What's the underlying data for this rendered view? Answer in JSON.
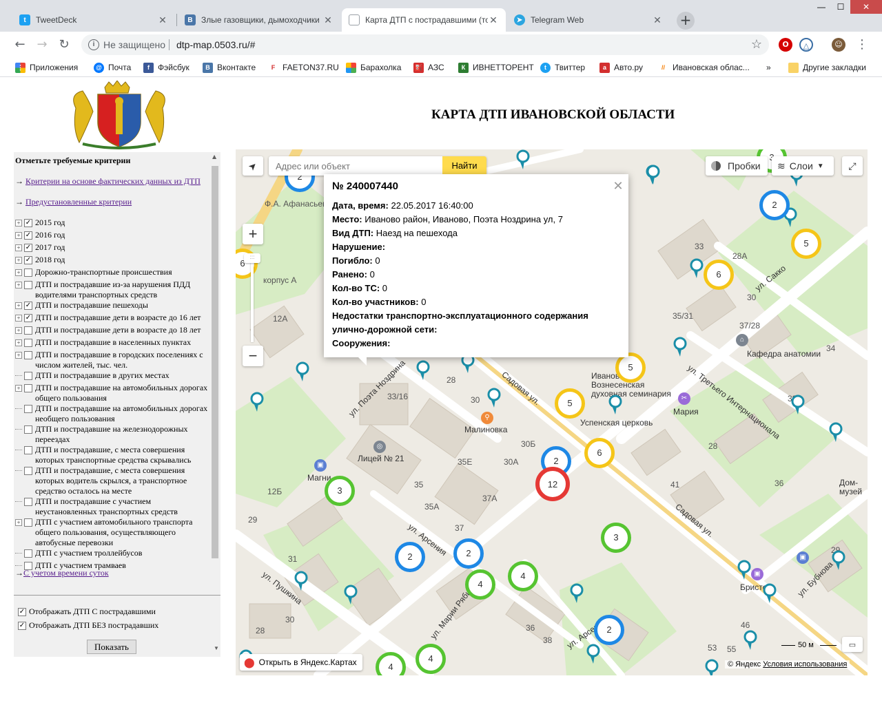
{
  "browser": {
    "tabs": [
      {
        "title": "TweetDeck",
        "active": false,
        "favicon": "twitter-icon",
        "color": "#1da1f2"
      },
      {
        "title": "Злые газовщики, дымоходчики",
        "active": false,
        "favicon": "vk-icon",
        "color": "#4a76a8"
      },
      {
        "title": "Карта ДТП с пострадавшими (то",
        "active": true,
        "favicon": "page-icon",
        "color": "#9aa0a6"
      },
      {
        "title": "Telegram Web",
        "active": false,
        "favicon": "telegram-icon",
        "color": "#2ca5e0"
      }
    ],
    "new_tab": "+",
    "window_buttons": {
      "minimize": "—",
      "maximize": "☐",
      "close": "✕"
    },
    "security_label": "Не защищено",
    "url": "dtp-map.0503.ru/#",
    "bookmarks": [
      {
        "label": "Приложения",
        "icon": "apps-icon",
        "color": "#ea4335"
      },
      {
        "label": "Почта",
        "icon": "mail-icon",
        "color": "#0078ff"
      },
      {
        "label": "Фэйсбук",
        "icon": "facebook-icon",
        "color": "#3b5998"
      },
      {
        "label": "Вконтакте",
        "icon": "vk-icon",
        "color": "#4a76a8"
      },
      {
        "label": "FAETON37.RU",
        "icon": "faeton-icon",
        "color": "#d32f2f"
      },
      {
        "label": "Барахолка",
        "icon": "baraholka-icon",
        "color": "#4caf50"
      },
      {
        "label": "АЗС",
        "icon": "azs-icon",
        "color": "#d32f2f"
      },
      {
        "label": "ИВНЕТТОРЕНТ",
        "icon": "torrent-icon",
        "color": "#2e7d32"
      },
      {
        "label": "Твиттер",
        "icon": "twitter-icon",
        "color": "#1da1f2"
      },
      {
        "label": "Авто.ру",
        "icon": "autoru-icon",
        "color": "#d32f2f"
      },
      {
        "label": "Ивановская облас...",
        "icon": "region-icon",
        "color": "#f57c00"
      }
    ],
    "bookmarks_more": "»",
    "other_bookmarks": "Другие закладки"
  },
  "page": {
    "title": "КАРТА ДТП ИВАНОВСКОЙ ОБЛАСТИ"
  },
  "sidebar": {
    "heading": "Отметьте требуемые критерии",
    "link_actual": "Критерии на основе фактических данных из ДТП",
    "link_preset": "Предустановленные критерии",
    "arrow": "→",
    "criteria": [
      {
        "label": "2015 год",
        "checked": true,
        "expandable": true
      },
      {
        "label": "2016 год",
        "checked": true,
        "expandable": true
      },
      {
        "label": "2017 год",
        "checked": true,
        "expandable": true
      },
      {
        "label": "2018 год",
        "checked": true,
        "expandable": true
      },
      {
        "label": "Дорожно-транспортные происшествия",
        "checked": false,
        "expandable": true
      },
      {
        "label": "ДТП и пострадавшие из-за нарушения ПДД водителями транспортных средств",
        "checked": false,
        "expandable": true
      },
      {
        "label": "ДТП и пострадавшие пешеходы",
        "checked": true,
        "expandable": true
      },
      {
        "label": "ДТП и пострадавшие дети в возрасте до 16 лет",
        "checked": true,
        "expandable": true
      },
      {
        "label": "ДТП и пострадавшие дети в возрасте до 18 лет",
        "checked": false,
        "expandable": true
      },
      {
        "label": "ДТП и пострадавшие в населенных пунктах",
        "checked": false,
        "expandable": true
      },
      {
        "label": "ДТП и пострадавшие в городских поселениях с числом жителей, тыс. чел.",
        "checked": false,
        "expandable": true
      },
      {
        "label": "ДТП и пострадавшие в других местах",
        "checked": false,
        "expandable": false
      },
      {
        "label": "ДТП и пострадавшие на автомобильных дорогах общего пользования",
        "checked": false,
        "expandable": true
      },
      {
        "label": "ДТП и пострадавшие на автомобильных дорогах необщего пользования",
        "checked": false,
        "expandable": false
      },
      {
        "label": "ДТП и пострадавшие на железнодорожных переездах",
        "checked": false,
        "expandable": false
      },
      {
        "label": "ДТП и пострадавшие, с места совершения которых транспортные средства скрывались",
        "checked": false,
        "expandable": false
      },
      {
        "label": "ДТП и пострадавшие, с места совершения которых водитель скрылся, а транспортное средство осталось на месте",
        "checked": false,
        "expandable": false
      },
      {
        "label": "ДТП и пострадавшие с участием неустановленных транспортных средств",
        "checked": false,
        "expandable": false
      },
      {
        "label": "ДТП с участием автомобильного транспорта общего пользования, осуществляющего автобусные перевозки",
        "checked": false,
        "expandable": true
      },
      {
        "label": "ДТП с участием троллейбусов",
        "checked": false,
        "expandable": false
      },
      {
        "label": "ДТП с участием трамваев",
        "checked": false,
        "expandable": false
      }
    ],
    "link_time": "С учетом времени суток",
    "opt_with_injured": "Отображать ДТП С пострадавшими",
    "opt_without_injured": "Отображать ДТП БЕЗ пострадавших",
    "show_button": "Показать"
  },
  "map": {
    "search_placeholder": "Адрес или объект",
    "find_button": "Найти",
    "traffic_button": "Пробки",
    "layers_button": "Слои",
    "zoom_in": "+",
    "zoom_out": "−",
    "open_in_yandex": "Открыть в Яндекс.Картах",
    "copyright": "© Яндекс",
    "terms": "Условия использования",
    "scale": "50 м",
    "colors": {
      "green": "#56c431",
      "blue": "#1e88e5",
      "yellow": "#f5c518",
      "red": "#e53935",
      "pin": "#1a8ea8"
    },
    "labels": [
      {
        "text": "ул. Поэта Ноздрина",
        "type": "street"
      },
      {
        "text": "Садовая ул.",
        "type": "street"
      },
      {
        "text": "ул. Сакко",
        "type": "street"
      },
      {
        "text": "ул. Третьего Интернационала",
        "type": "street"
      },
      {
        "text": "ул. Пушкина",
        "type": "street"
      },
      {
        "text": "ул. Арсения",
        "type": "street"
      },
      {
        "text": "ул. Марии Рябининой",
        "type": "street"
      },
      {
        "text": "ул. Бубнова",
        "type": "street"
      },
      {
        "text": "Ф.А. Афанасьев",
        "type": "poi"
      },
      {
        "text": "Кафедра анатомии",
        "type": "poi"
      },
      {
        "text": "Иваново-Вознесенская духовная семинария",
        "type": "poi"
      },
      {
        "text": "Успенская церковь",
        "type": "poi"
      },
      {
        "text": "Мария",
        "type": "poi"
      },
      {
        "text": "Малиновка",
        "type": "poi"
      },
      {
        "text": "Лицей № 21",
        "type": "poi"
      },
      {
        "text": "Магнит",
        "type": "poi"
      },
      {
        "text": "Дом-музей семьи Бубновых",
        "type": "poi"
      },
      {
        "text": "Бристоль",
        "type": "poi"
      },
      {
        "text": "корпус А",
        "type": "house"
      },
      {
        "text": "33/16",
        "type": "house"
      },
      {
        "text": "28",
        "type": "house"
      },
      {
        "text": "30",
        "type": "house"
      },
      {
        "text": "30Б",
        "type": "house"
      },
      {
        "text": "30А",
        "type": "house"
      },
      {
        "text": "35Е",
        "type": "house"
      },
      {
        "text": "35",
        "type": "house"
      },
      {
        "text": "35А",
        "type": "house"
      },
      {
        "text": "37А",
        "type": "house"
      },
      {
        "text": "37",
        "type": "house"
      },
      {
        "text": "12А",
        "type": "house"
      },
      {
        "text": "12Б",
        "type": "house"
      },
      {
        "text": "29",
        "type": "house"
      },
      {
        "text": "31",
        "type": "house"
      },
      {
        "text": "30",
        "type": "house"
      },
      {
        "text": "28",
        "type": "house"
      },
      {
        "text": "33",
        "type": "house"
      },
      {
        "text": "28А",
        "type": "house"
      },
      {
        "text": "35/31",
        "type": "house"
      },
      {
        "text": "37/28",
        "type": "house"
      },
      {
        "text": "30",
        "type": "house"
      },
      {
        "text": "34",
        "type": "house"
      },
      {
        "text": "39",
        "type": "house"
      },
      {
        "text": "28",
        "type": "house"
      },
      {
        "text": "41",
        "type": "house"
      },
      {
        "text": "36",
        "type": "house"
      },
      {
        "text": "36",
        "type": "house"
      },
      {
        "text": "38",
        "type": "house"
      },
      {
        "text": "46",
        "type": "house"
      },
      {
        "text": "53",
        "type": "house"
      },
      {
        "text": "55",
        "type": "house"
      },
      {
        "text": "29",
        "type": "house"
      }
    ],
    "clusters": [
      {
        "count": 2,
        "color": "blue"
      },
      {
        "count": 5,
        "color": "yellow"
      },
      {
        "count": 6,
        "color": "yellow"
      },
      {
        "count": 5,
        "color": "yellow"
      },
      {
        "count": 5,
        "color": "yellow"
      },
      {
        "count": 6,
        "color": "yellow"
      },
      {
        "count": 2,
        "color": "blue"
      },
      {
        "count": 12,
        "color": "red"
      },
      {
        "count": 3,
        "color": "green"
      },
      {
        "count": 3,
        "color": "green"
      },
      {
        "count": 2,
        "color": "blue"
      },
      {
        "count": 2,
        "color": "blue"
      },
      {
        "count": 4,
        "color": "green"
      },
      {
        "count": 4,
        "color": "green"
      },
      {
        "count": 2,
        "color": "blue"
      },
      {
        "count": 4,
        "color": "green"
      },
      {
        "count": 4,
        "color": "green"
      },
      {
        "count": 6,
        "color": "yellow"
      },
      {
        "count": 2,
        "color": "blue"
      },
      {
        "count": 3,
        "color": "green"
      }
    ]
  },
  "popup": {
    "title": "№ 240007440",
    "close": "✕",
    "fields": [
      {
        "label": "Дата, время:",
        "value": "22.05.2017 16:40:00"
      },
      {
        "label": "Место:",
        "value": "Иваново район, Иваново, Поэта Ноздрина ул, 7"
      },
      {
        "label": "Вид ДТП:",
        "value": "Наезд на пешехода"
      },
      {
        "label": "Нарушение:",
        "value": ""
      },
      {
        "label": "Погибло:",
        "value": "0"
      },
      {
        "label": "Ранено:",
        "value": "0"
      },
      {
        "label": "Кол-во ТС:",
        "value": "0"
      },
      {
        "label": "Кол-во участников:",
        "value": "0"
      },
      {
        "label": "Недостатки транспортно-эксплуатационного содержания",
        "value": ""
      },
      {
        "label": "улично-дорожной сети:",
        "value": ""
      },
      {
        "label": "Сооружения:",
        "value": ""
      }
    ]
  }
}
